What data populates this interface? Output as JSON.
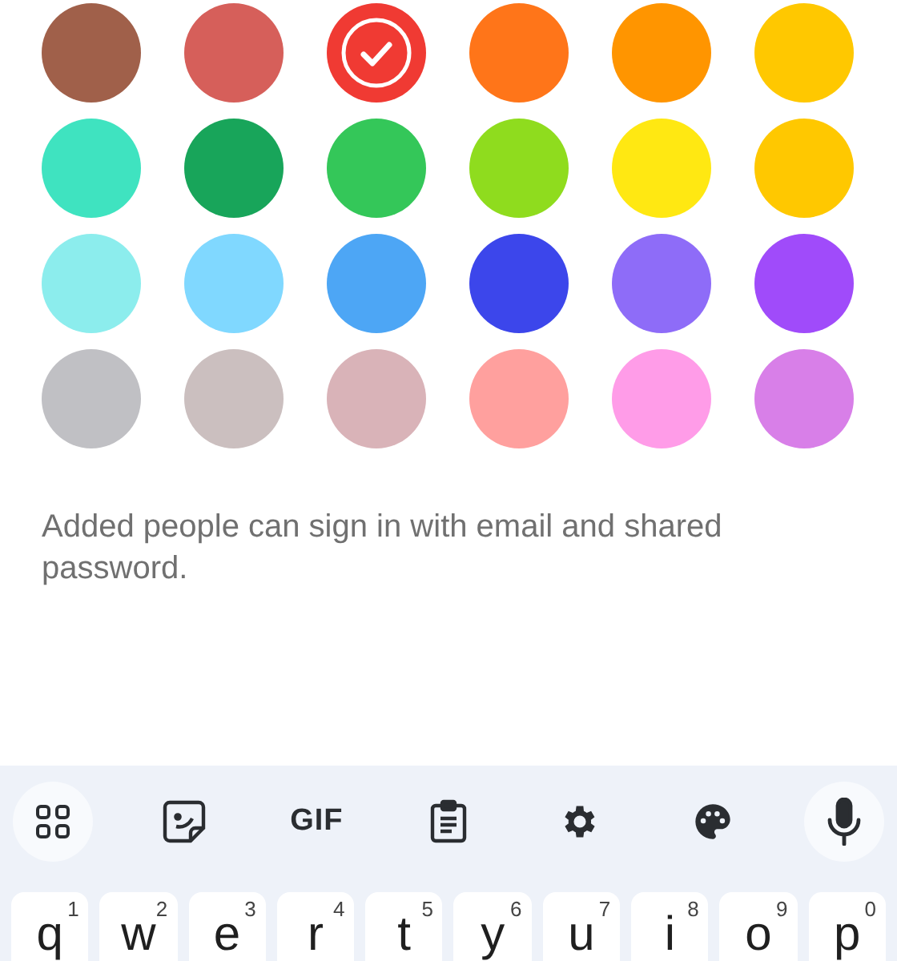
{
  "swatches": [
    {
      "color": "#a0604a",
      "selected": false
    },
    {
      "color": "#d65f5a",
      "selected": false
    },
    {
      "color": "#f03a33",
      "selected": true
    },
    {
      "color": "#ff7519",
      "selected": false
    },
    {
      "color": "#ff9500",
      "selected": false
    },
    {
      "color": "#ffc800",
      "selected": false
    },
    {
      "color": "#3fe3c0",
      "selected": false
    },
    {
      "color": "#18a55a",
      "selected": false
    },
    {
      "color": "#34c759",
      "selected": false
    },
    {
      "color": "#8fdc1e",
      "selected": false
    },
    {
      "color": "#ffe812",
      "selected": false
    },
    {
      "color": "#ffc800",
      "selected": false
    },
    {
      "color": "#8ceded",
      "selected": false
    },
    {
      "color": "#80d8ff",
      "selected": false
    },
    {
      "color": "#4da6f5",
      "selected": false
    },
    {
      "color": "#3c46eb",
      "selected": false
    },
    {
      "color": "#8e6cf8",
      "selected": false
    },
    {
      "color": "#a04bfa",
      "selected": false
    },
    {
      "color": "#c0c0c4",
      "selected": false
    },
    {
      "color": "#cbbfbf",
      "selected": false
    },
    {
      "color": "#d9b3b8",
      "selected": false
    },
    {
      "color": "#ffa09e",
      "selected": false
    },
    {
      "color": "#ff9ce8",
      "selected": false
    },
    {
      "color": "#d87fe8",
      "selected": false
    }
  ],
  "note": "Added people can sign in with email and shared password.",
  "keyboard": {
    "toolbar": [
      {
        "kind": "apps"
      },
      {
        "kind": "sticker"
      },
      {
        "kind": "gif",
        "text": "GIF"
      },
      {
        "kind": "clipboard"
      },
      {
        "kind": "settings"
      },
      {
        "kind": "theme"
      },
      {
        "kind": "mic"
      }
    ],
    "keys": [
      {
        "letter": "q",
        "hint": "1"
      },
      {
        "letter": "w",
        "hint": "2"
      },
      {
        "letter": "e",
        "hint": "3"
      },
      {
        "letter": "r",
        "hint": "4"
      },
      {
        "letter": "t",
        "hint": "5"
      },
      {
        "letter": "y",
        "hint": "6"
      },
      {
        "letter": "u",
        "hint": "7"
      },
      {
        "letter": "i",
        "hint": "8"
      },
      {
        "letter": "o",
        "hint": "9"
      },
      {
        "letter": "p",
        "hint": "0"
      }
    ]
  }
}
